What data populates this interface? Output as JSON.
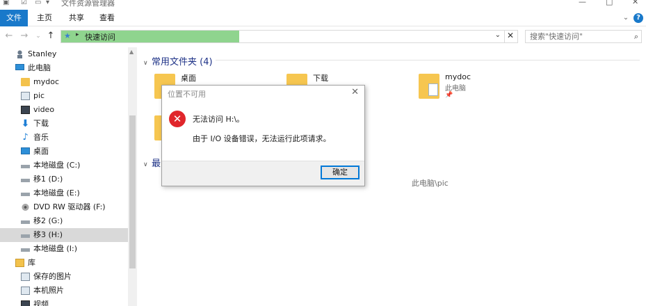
{
  "window": {
    "title": "文件资源管理器",
    "minimize": "—",
    "maximize": "□",
    "close": "✕"
  },
  "ribbon": {
    "tabs": [
      {
        "label": "文件",
        "active": true
      },
      {
        "label": "主页"
      },
      {
        "label": "共享"
      },
      {
        "label": "查看"
      }
    ],
    "expand_glyph": "⌄",
    "help_glyph": "?"
  },
  "addressbar": {
    "back_glyph": "←",
    "forward_glyph": "→",
    "recent_glyph": "⌄",
    "up_glyph": "↑",
    "separator": "▸",
    "crumb": "快速访问",
    "dropdown_glyph": "⌄",
    "clear_glyph": "✕",
    "search_placeholder": "搜索\"快速访问\"",
    "search_glyph": "⌕"
  },
  "nav": {
    "items": [
      {
        "label": "Stanley",
        "icon": "user-icon"
      },
      {
        "label": "此电脑",
        "icon": "pc-icon"
      },
      {
        "label": "mydoc",
        "icon": "folder-icon"
      },
      {
        "label": "pic",
        "icon": "image-icon"
      },
      {
        "label": "video",
        "icon": "video-icon"
      },
      {
        "label": "下载",
        "icon": "download-icon"
      },
      {
        "label": "音乐",
        "icon": "music-icon"
      },
      {
        "label": "桌面",
        "icon": "desktop-icon"
      },
      {
        "label": "本地磁盘 (C:)",
        "icon": "drive-icon"
      },
      {
        "label": "移1 (D:)",
        "icon": "drive-icon"
      },
      {
        "label": "本地磁盘 (E:)",
        "icon": "drive-icon"
      },
      {
        "label": "DVD RW 驱动器 (F:)",
        "icon": "dvd-icon"
      },
      {
        "label": "移2 (G:)",
        "icon": "drive-icon"
      },
      {
        "label": "移3 (H:)",
        "icon": "drive-icon",
        "selected": true
      },
      {
        "label": "本地磁盘 (I:)",
        "icon": "drive-icon"
      },
      {
        "label": "库",
        "icon": "library-icon"
      },
      {
        "label": "保存的图片",
        "icon": "image-icon"
      },
      {
        "label": "本机照片",
        "icon": "image-icon"
      },
      {
        "label": "视频",
        "icon": "video-icon"
      }
    ]
  },
  "content": {
    "frequent_header": "常用文件夹 (4)",
    "frequent": [
      {
        "name": "桌面"
      },
      {
        "name": "下载"
      },
      {
        "name": "mydoc",
        "sub": "此电脑",
        "pin": "📌"
      }
    ],
    "recent_header_visible": "最",
    "recent_path": "此电脑\\pic"
  },
  "dialog": {
    "title": "位置不可用",
    "close_glyph": "✕",
    "error_glyph": "✕",
    "message_line1": "无法访问 H:\\。",
    "message_line2": "由于 I/O 设备错误，无法运行此项请求。",
    "ok_label": "确定"
  },
  "colors": {
    "accent": "#1979ca",
    "address_fill": "#8fd48e",
    "error_red": "#e0262b",
    "header_blue": "#1e3287"
  }
}
